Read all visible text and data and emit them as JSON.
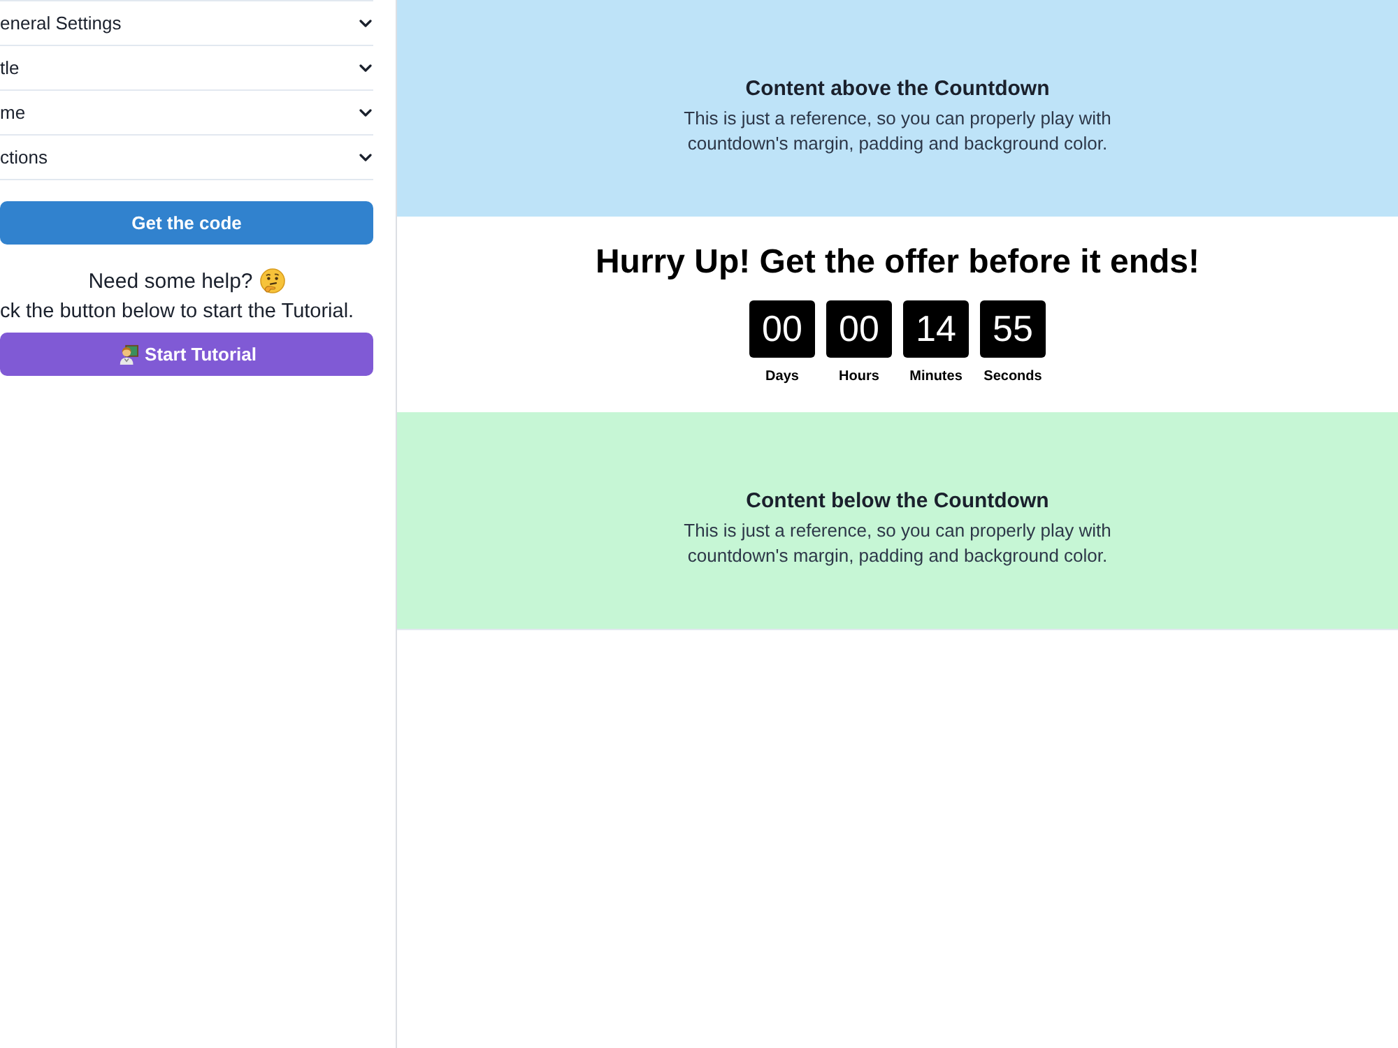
{
  "sidebar": {
    "accordion": [
      {
        "label": "eneral Settings",
        "expanded": false
      },
      {
        "label": "tle",
        "expanded": false
      },
      {
        "label": "me",
        "expanded": false
      },
      {
        "label": "ctions",
        "expanded": false
      }
    ],
    "code_button": "Get the code",
    "help": {
      "title": "Need some help?",
      "text": "ck the button below to start the Tutorial."
    },
    "tutorial_button": "Start Tutorial"
  },
  "preview": {
    "sections": [
      {
        "kind": "reference",
        "color": "#bee3f8",
        "title": "Content above the Countdown",
        "text": "This is just a reference, so you can properly play with countdown's margin, padding and background color."
      },
      {
        "kind": "countdown",
        "title": "Hurry Up! Get the offer before it ends!",
        "units": [
          {
            "value": "00",
            "label": "Days"
          },
          {
            "value": "00",
            "label": "Hours"
          },
          {
            "value": "14",
            "label": "Minutes"
          },
          {
            "value": "55",
            "label": "Seconds"
          }
        ]
      },
      {
        "kind": "reference",
        "color": "#c6f6d5",
        "title": "Content below the Countdown",
        "text": "This is just a reference, so you can properly play with countdown's margin, padding and background color."
      }
    ]
  }
}
